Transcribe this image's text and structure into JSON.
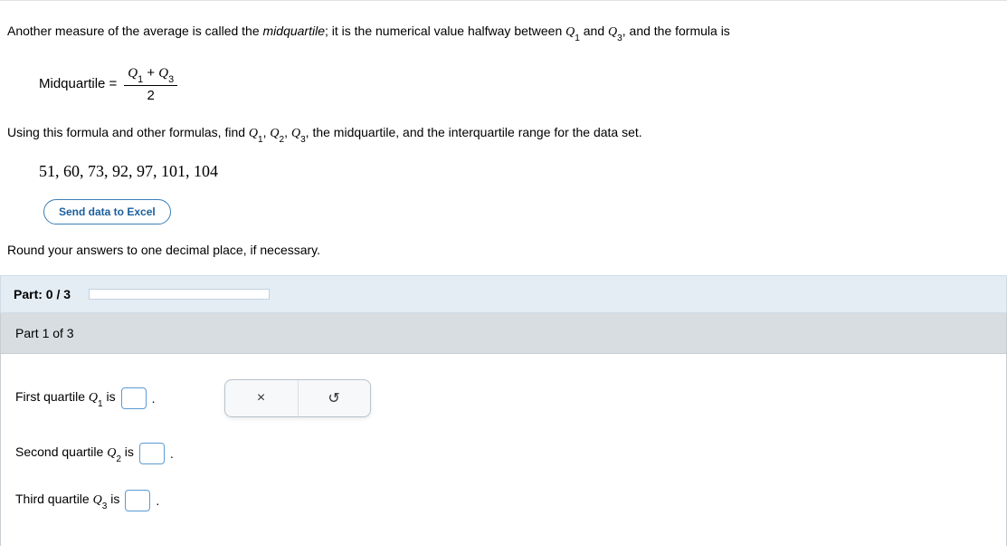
{
  "intro": {
    "text_before_term": "Another measure of the average is called the ",
    "term": "midquartile",
    "text_after_term": "; it is the numerical value halfway between ",
    "q1": "Q",
    "q1_sub": "1",
    "between_and": " and ",
    "q3": "Q",
    "q3_sub": "3",
    "text_tail": ", and the formula is"
  },
  "formula": {
    "lhs": "Midquartile =",
    "num": "Q₁ + Q₃",
    "den": "2"
  },
  "instruction": {
    "before": "Using this formula and other formulas, find ",
    "q1": "Q",
    "q1_sub": "1",
    "c1": ", ",
    "q2": "Q",
    "q2_sub": "2",
    "c2": ", ",
    "q3": "Q",
    "q3_sub": "3",
    "after": ", the midquartile, and the interquartile range for the data set."
  },
  "data_set": "51, 60, 73, 92, 97, 101, 104",
  "excel_button": "Send data to Excel",
  "round_note": "Round your answers to one decimal place, if necessary.",
  "progress": {
    "label": "Part: 0 / 3",
    "percent": 0
  },
  "part_header": "Part 1 of 3",
  "answers": {
    "q1": {
      "label_before": "First quartile ",
      "var": "Q",
      "sub": "1",
      "label_after": " is",
      "value": "",
      "period": "."
    },
    "q2": {
      "label_before": "Second quartile ",
      "var": "Q",
      "sub": "2",
      "label_after": " is",
      "value": "",
      "period": "."
    },
    "q3": {
      "label_before": "Third quartile ",
      "var": "Q",
      "sub": "3",
      "label_after": " is",
      "value": "",
      "period": "."
    }
  },
  "toolbox": {
    "clear": "×",
    "reset": "↺"
  }
}
